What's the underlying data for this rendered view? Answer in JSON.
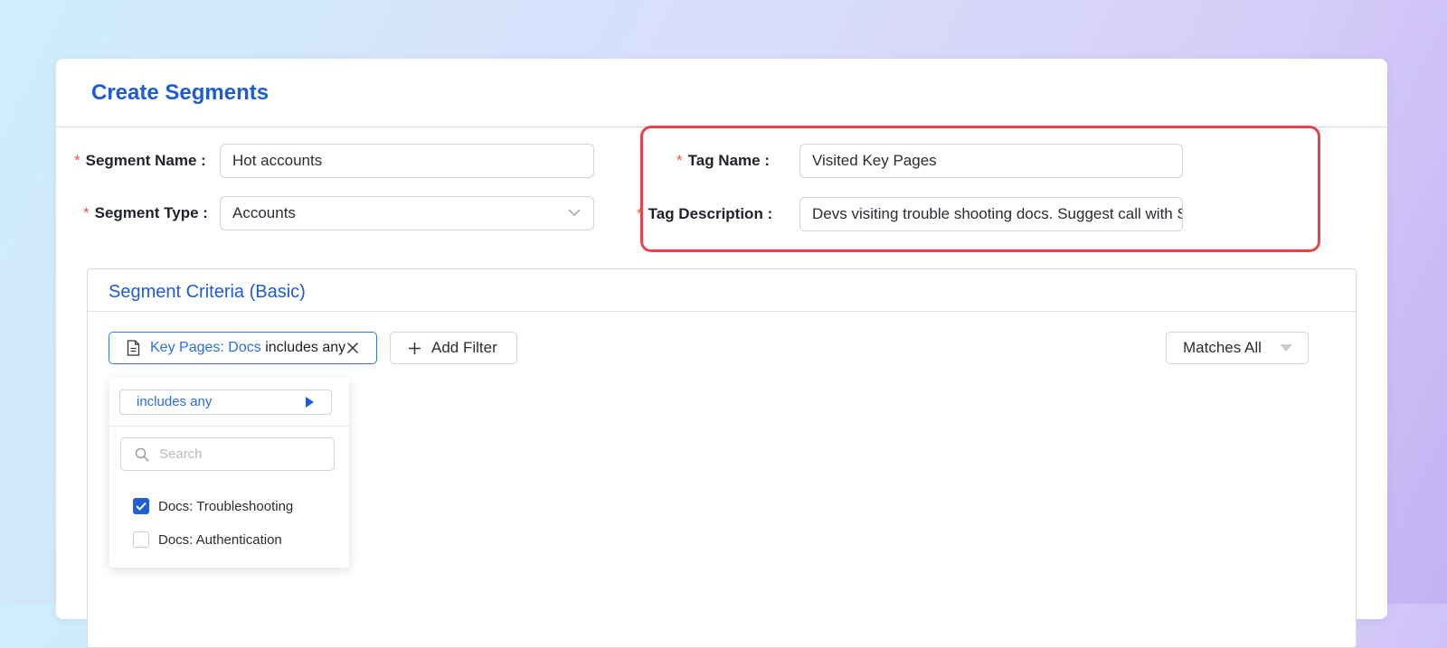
{
  "page": {
    "title": "Create Segments"
  },
  "form": {
    "segment_name": {
      "label": "Segment Name :",
      "value": "Hot accounts"
    },
    "segment_type": {
      "label": "Segment Type :",
      "value": "Accounts"
    },
    "tag_name": {
      "label": "Tag Name :",
      "value": "Visited Key Pages"
    },
    "tag_description": {
      "label": "Tag Description :",
      "value": "Devs visiting trouble shooting docs. Suggest call with Sales Eng"
    },
    "required_marker": "*"
  },
  "criteria": {
    "title": "Segment Criteria (Basic)",
    "filter_chip": {
      "field": "Key Pages: Docs",
      "operator": "includes any"
    },
    "add_filter_label": "Add Filter",
    "matches_label": "Matches All"
  },
  "dropdown": {
    "operator": "includes any",
    "search_placeholder": "Search",
    "options": [
      {
        "label": "Docs: Troubleshooting",
        "checked": true
      },
      {
        "label": "Docs: Authentication",
        "checked": false
      }
    ]
  },
  "colors": {
    "accent": "#1e5bd6",
    "highlight": "#e8434a",
    "required": "#f0504a"
  },
  "icons": [
    "document-icon",
    "close-icon",
    "plus-icon",
    "caret-down-icon",
    "chevron-down-icon",
    "play-right-icon",
    "search-icon",
    "checkmark-icon"
  ]
}
